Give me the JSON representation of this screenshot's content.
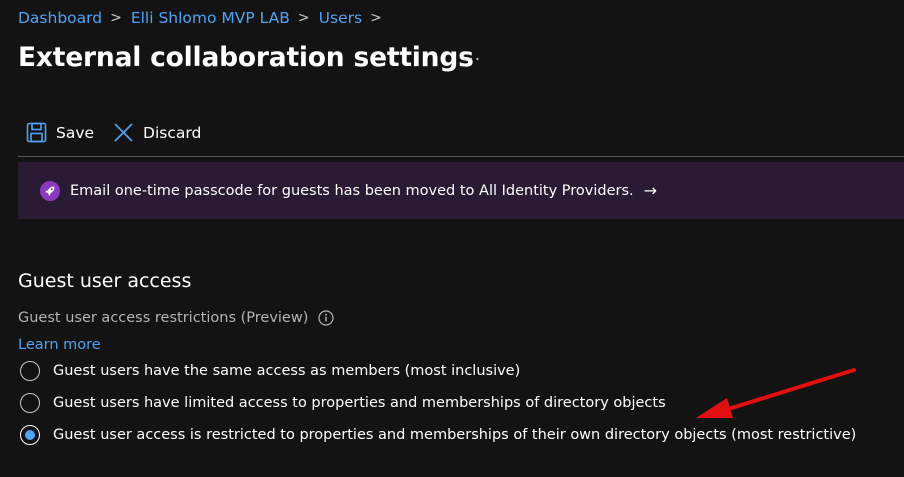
{
  "breadcrumb": {
    "items": [
      "Dashboard",
      "Elli Shlomo MVP LAB",
      "Users"
    ],
    "separator": ">"
  },
  "page": {
    "title": "External collaboration settings",
    "more_label": "···"
  },
  "toolbar": {
    "save_label": "Save",
    "discard_label": "Discard",
    "save_icon": "save-icon",
    "discard_icon": "close-icon"
  },
  "banner": {
    "text": "Email one-time passcode for guests has been moved to All Identity Providers.",
    "arrow": "→",
    "icon": "rocket-icon"
  },
  "guest_access": {
    "section_title": "Guest user access",
    "field_label": "Guest user access restrictions (Preview)",
    "learn_more": "Learn more",
    "options": [
      {
        "label": "Guest users have the same access as members (most inclusive)",
        "selected": false
      },
      {
        "label": "Guest users have limited access to properties and memberships of directory objects",
        "selected": false
      },
      {
        "label": "Guest user access is restricted to properties and memberships of their own directory objects (most restrictive)",
        "selected": true
      }
    ]
  },
  "colors": {
    "background": "#131313",
    "link": "#4fa3f5",
    "banner_bg": "#2a1a33",
    "banner_icon": "#8a3bbd",
    "annotation_arrow": "#e01010"
  }
}
